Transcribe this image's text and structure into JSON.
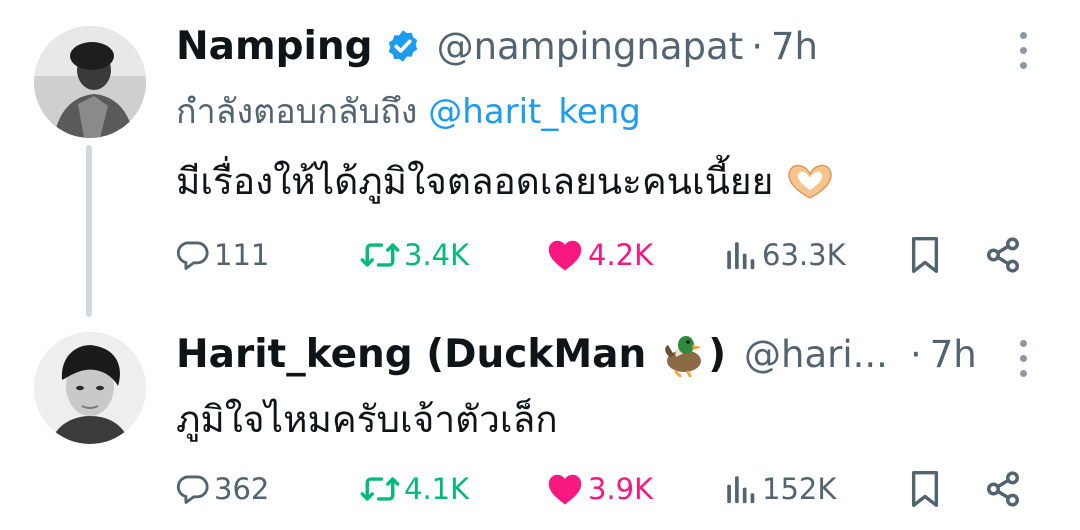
{
  "tweets": [
    {
      "display_name": "Namping",
      "verified": true,
      "handle": "@nampingnapat",
      "time_sep": "·",
      "time": "7h",
      "reply_prefix": "กำลังตอบกลับถึง",
      "reply_mention": "@harit_keng",
      "text": "มีเรื่องให้ได้ภูมิใจตลอดเลยนะคนเนี้ยย",
      "text_emoji": "heart-hands-emoji",
      "stats": {
        "replies": "111",
        "reposts": "3.4K",
        "likes": "4.2K",
        "views": "63.3K"
      }
    },
    {
      "display_name": "Harit_keng (DuckMan",
      "name_emoji": "duck-emoji",
      "display_name_close": ")",
      "handle": "@hari...",
      "time_sep": "·",
      "time": "7h",
      "text": "ภูมิใจไหมครับเจ้าตัวเล็ก",
      "stats": {
        "replies": "362",
        "reposts": "4.1K",
        "likes": "3.9K",
        "views": "152K"
      }
    }
  ],
  "colors": {
    "text": "#0f1419",
    "secondary": "#536471",
    "link": "#1d9bf0",
    "repost": "#00ba7c",
    "like": "#f91880",
    "thread_line": "#cfd9de"
  },
  "icons": [
    "verified-badge-icon",
    "more-icon",
    "reply-icon",
    "repost-icon",
    "like-icon",
    "views-icon",
    "bookmark-icon",
    "share-icon"
  ]
}
